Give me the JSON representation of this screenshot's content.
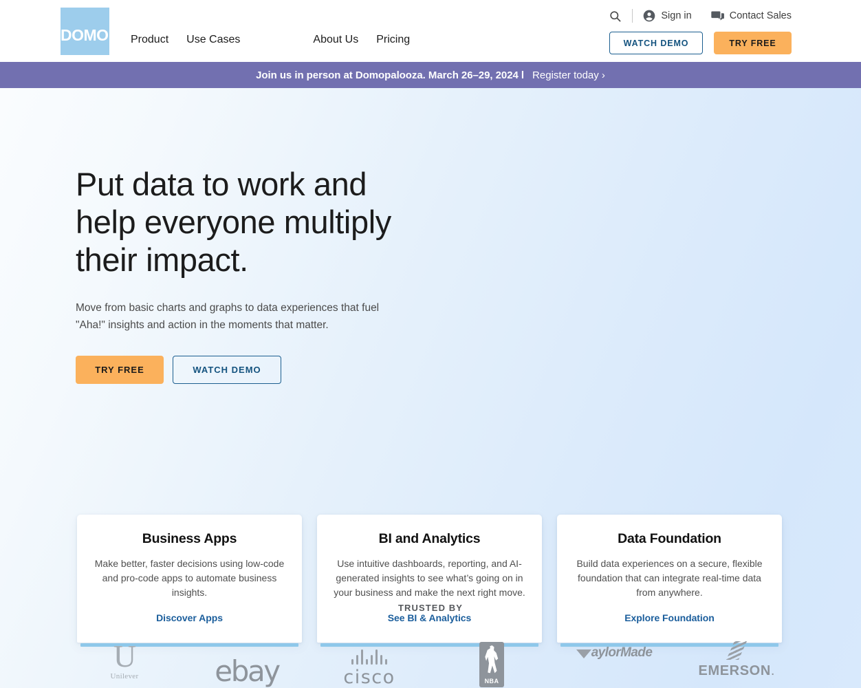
{
  "brand": {
    "logo_text": "DOMO",
    "logo_bg_color": "#9dcdec",
    "accent_orange": "#fbb15c",
    "accent_blue": "#14537f",
    "banner_purple": "#7270b0",
    "card_accent": "#8ec8ea"
  },
  "header": {
    "nav": [
      {
        "label": "Product"
      },
      {
        "label": "Use Cases"
      },
      {
        "label": "About Us"
      },
      {
        "label": "Pricing"
      }
    ],
    "search_icon": "search-icon",
    "sign_in": {
      "label": "Sign in",
      "icon": "account-circle-icon"
    },
    "contact_sales": {
      "label": "Contact Sales",
      "icon": "chat-bubbles-icon"
    },
    "watch_demo_label": "WATCH DEMO",
    "try_free_label": "TRY FREE"
  },
  "announcement": {
    "bold_text": "Join us in person at Domopalooza. March 26–29, 2024 l",
    "link_text": "Register today ›"
  },
  "hero": {
    "title": "Put data to work and help everyone multiply their impact.",
    "subtitle": "Move from basic charts and graphs to data experiences that fuel \"Aha!\" insights and action in the moments that matter.",
    "primary_cta": "TRY FREE",
    "secondary_cta": "WATCH DEMO"
  },
  "cards": [
    {
      "title": "Business Apps",
      "description": "Make better, faster decisions using low-code and pro-code apps to automate business insights.",
      "link": "Discover Apps"
    },
    {
      "title": "BI and Analytics",
      "description": "Use intuitive dashboards, reporting, and AI-generated insights to see what’s going on in your business and make the next right move.",
      "link": "See BI & Analytics"
    },
    {
      "title": "Data Foundation",
      "description": "Build data experiences on a secure, flexible foundation that can integrate real-time data from anywhere.",
      "link": "Explore Foundation"
    }
  ],
  "trusted": {
    "label": "TRUSTED BY",
    "logos": [
      {
        "name": "Unilever",
        "glyph": "U"
      },
      {
        "name": "ebay"
      },
      {
        "name": "cisco"
      },
      {
        "name": "NBA"
      },
      {
        "name": "aylorMade",
        "prefix": "T"
      },
      {
        "name": "EMERSON",
        "suffix": "."
      }
    ]
  }
}
